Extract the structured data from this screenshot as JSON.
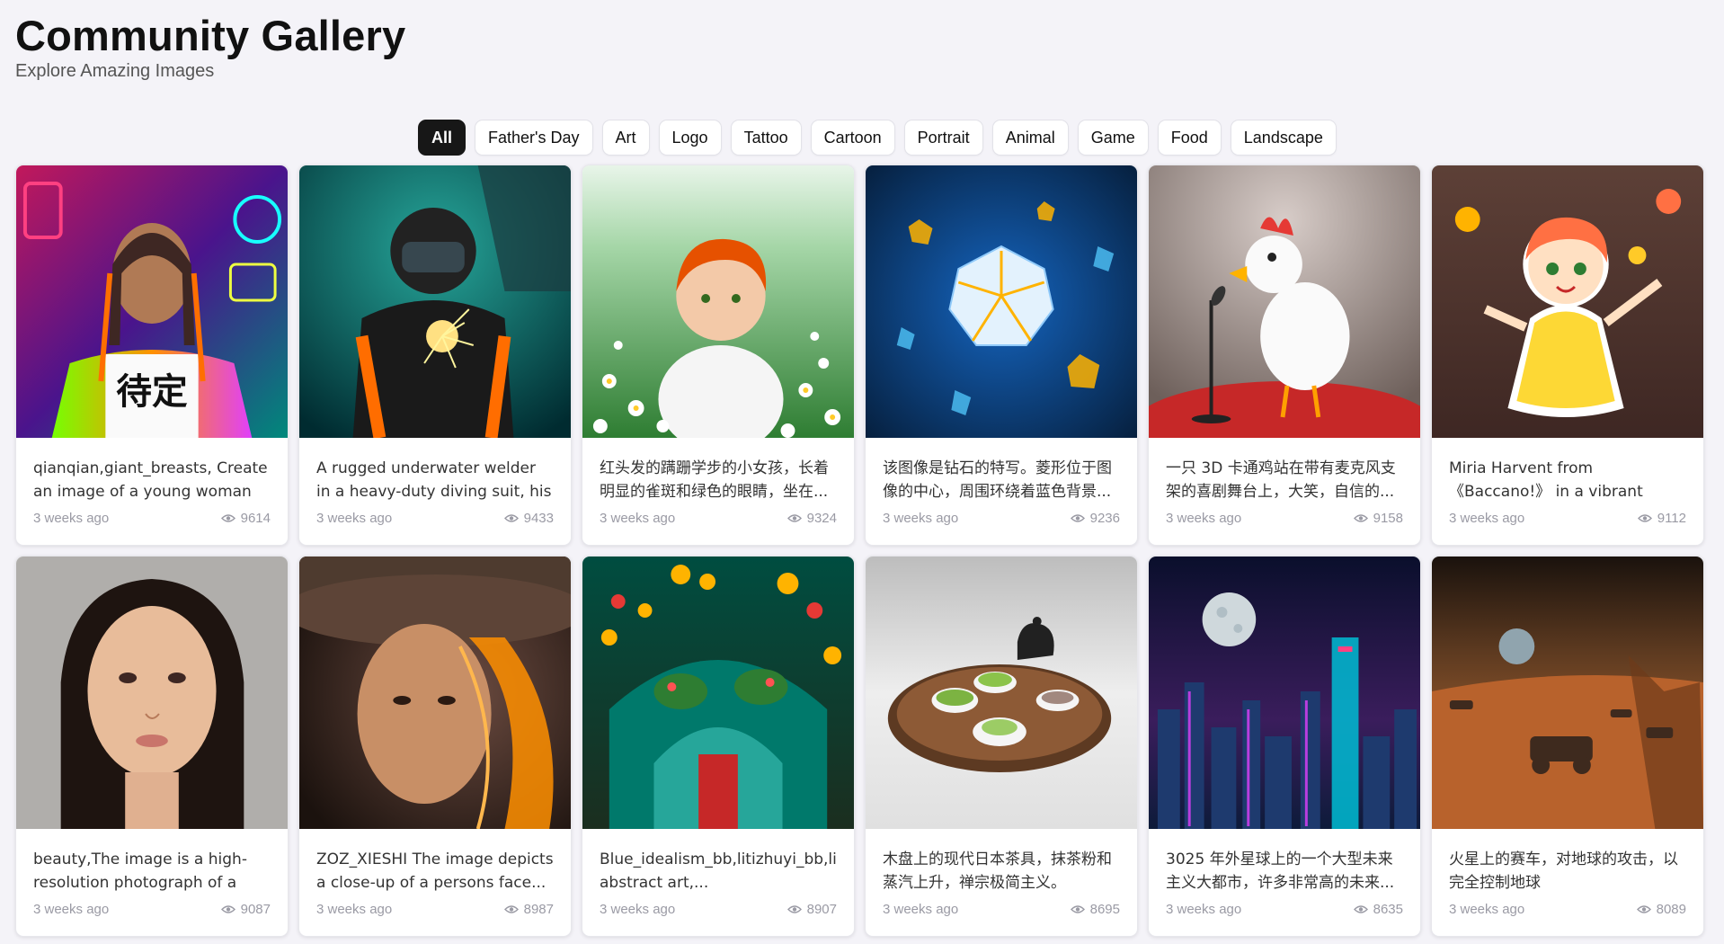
{
  "header": {
    "title": "Community Gallery",
    "subtitle": "Explore Amazing Images"
  },
  "tabs": [
    "All",
    "Father's Day",
    "Art",
    "Logo",
    "Tattoo",
    "Cartoon",
    "Portrait",
    "Animal",
    "Game",
    "Food",
    "Landscape"
  ],
  "active_tab": "All",
  "cards": [
    {
      "prompt": "qianqian,giant_breasts, Create an image of a young woman with...",
      "time": "3 weeks ago",
      "views": "9614",
      "thumb": "neon-portrait"
    },
    {
      "prompt": "A rugged underwater welder in a heavy-duty diving suit, his face...",
      "time": "3 weeks ago",
      "views": "9433",
      "thumb": "underwater-welder"
    },
    {
      "prompt": "红头发的蹒跚学步的小女孩，长着明显的雀斑和绿色的眼睛，坐在...",
      "time": "3 weeks ago",
      "views": "9324",
      "thumb": "daisy-field-child"
    },
    {
      "prompt": "该图像是钻石的特写。菱形位于图像的中心，周围环绕着蓝色背景...",
      "time": "3 weeks ago",
      "views": "9236",
      "thumb": "diamond-closeup"
    },
    {
      "prompt": "一只 3D 卡通鸡站在带有麦克风支架的喜剧舞台上，大笑，自信的...",
      "time": "3 weeks ago",
      "views": "9158",
      "thumb": "cartoon-chicken"
    },
    {
      "prompt": "Miria Harvent from 《Baccano!》 in a vibrant anime sticker style,...",
      "time": "3 weeks ago",
      "views": "9112",
      "thumb": "anime-sticker"
    },
    {
      "prompt": "beauty,The image is a high-resolution photograph of a you...",
      "time": "3 weeks ago",
      "views": "9087",
      "thumb": "beauty-portrait"
    },
    {
      "prompt": "ZOZ_XIESHI The image depicts a close-up of a persons face...",
      "time": "3 weeks ago",
      "views": "8987",
      "thumb": "hat-portrait"
    },
    {
      "prompt": "Blue_idealism_bb,litizhuyi_bb,litizh abstract art,...",
      "time": "3 weeks ago",
      "views": "8907",
      "thumb": "dragon-lanterns"
    },
    {
      "prompt": "木盘上的现代日本茶具，抹茶粉和蒸汽上升，禅宗极简主义。",
      "time": "3 weeks ago",
      "views": "8695",
      "thumb": "tea-set"
    },
    {
      "prompt": "3025 年外星球上的一个大型未来主义大都市，许多非常高的未来...",
      "time": "3 weeks ago",
      "views": "8635",
      "thumb": "future-city"
    },
    {
      "prompt": "火星上的赛车，对地球的攻击，以完全控制地球",
      "time": "3 weeks ago",
      "views": "8089",
      "thumb": "mars-racers"
    }
  ],
  "colors": {
    "active_tab_bg": "#171717",
    "page_bg": "#f4f3f8",
    "meta_text": "#9a9aa4"
  },
  "icons": {
    "views": "eye-icon"
  }
}
